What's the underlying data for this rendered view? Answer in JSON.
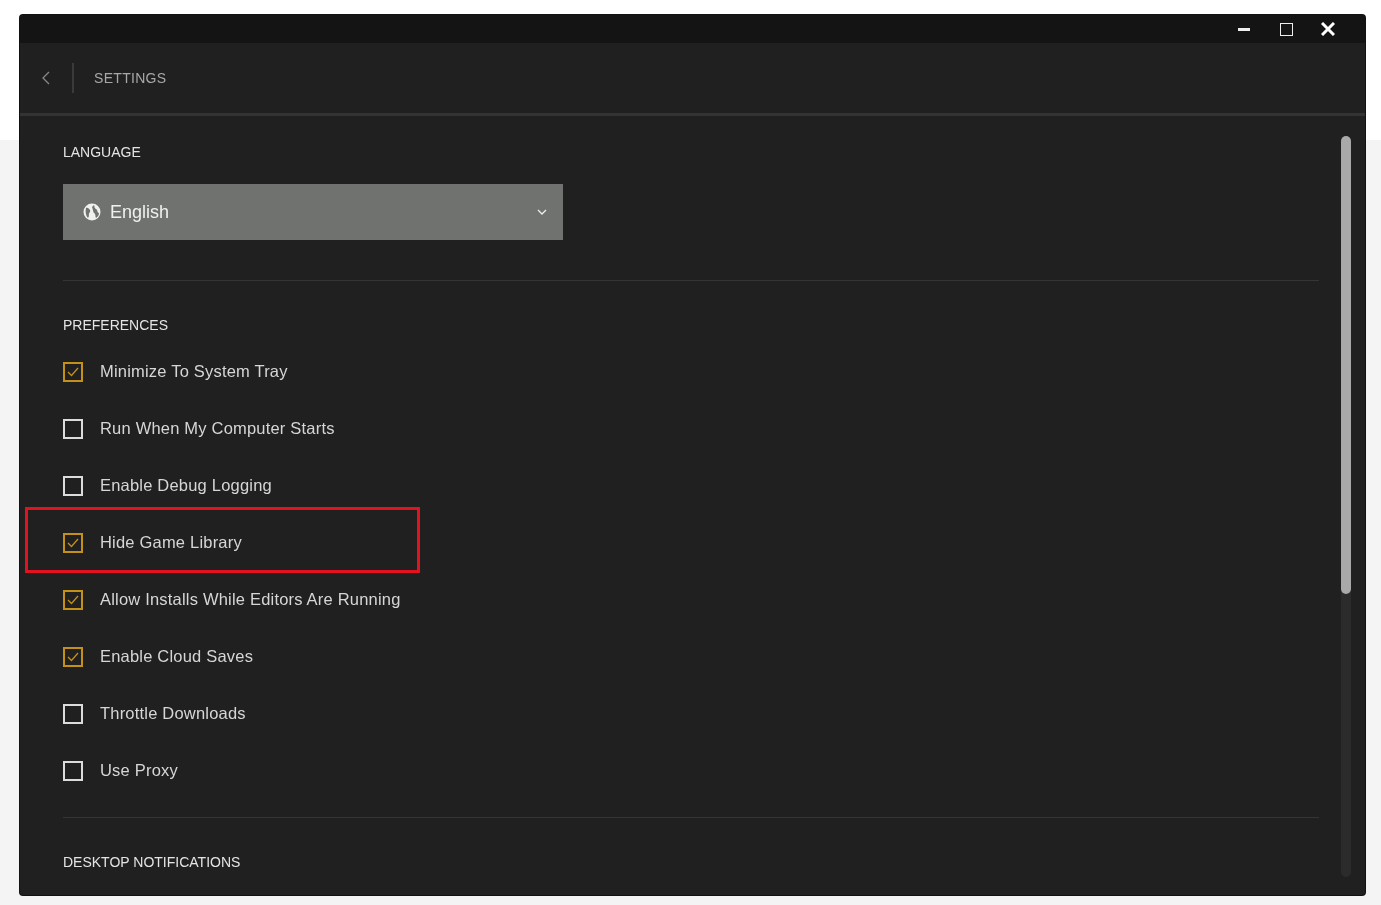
{
  "header": {
    "title": "SETTINGS"
  },
  "language": {
    "heading": "LANGUAGE",
    "value": "English"
  },
  "preferences": {
    "heading": "PREFERENCES",
    "items": [
      {
        "label": "Minimize To System Tray",
        "checked": true,
        "highlighted": false
      },
      {
        "label": "Run When My Computer Starts",
        "checked": false,
        "highlighted": false
      },
      {
        "label": "Enable Debug Logging",
        "checked": false,
        "highlighted": false
      },
      {
        "label": "Hide Game Library",
        "checked": true,
        "highlighted": true
      },
      {
        "label": "Allow Installs While Editors Are Running",
        "checked": true,
        "highlighted": false
      },
      {
        "label": "Enable Cloud Saves",
        "checked": true,
        "highlighted": false
      },
      {
        "label": "Throttle Downloads",
        "checked": false,
        "highlighted": false
      },
      {
        "label": "Use Proxy",
        "checked": false,
        "highlighted": false
      }
    ]
  },
  "notifications": {
    "heading": "DESKTOP NOTIFICATIONS"
  }
}
